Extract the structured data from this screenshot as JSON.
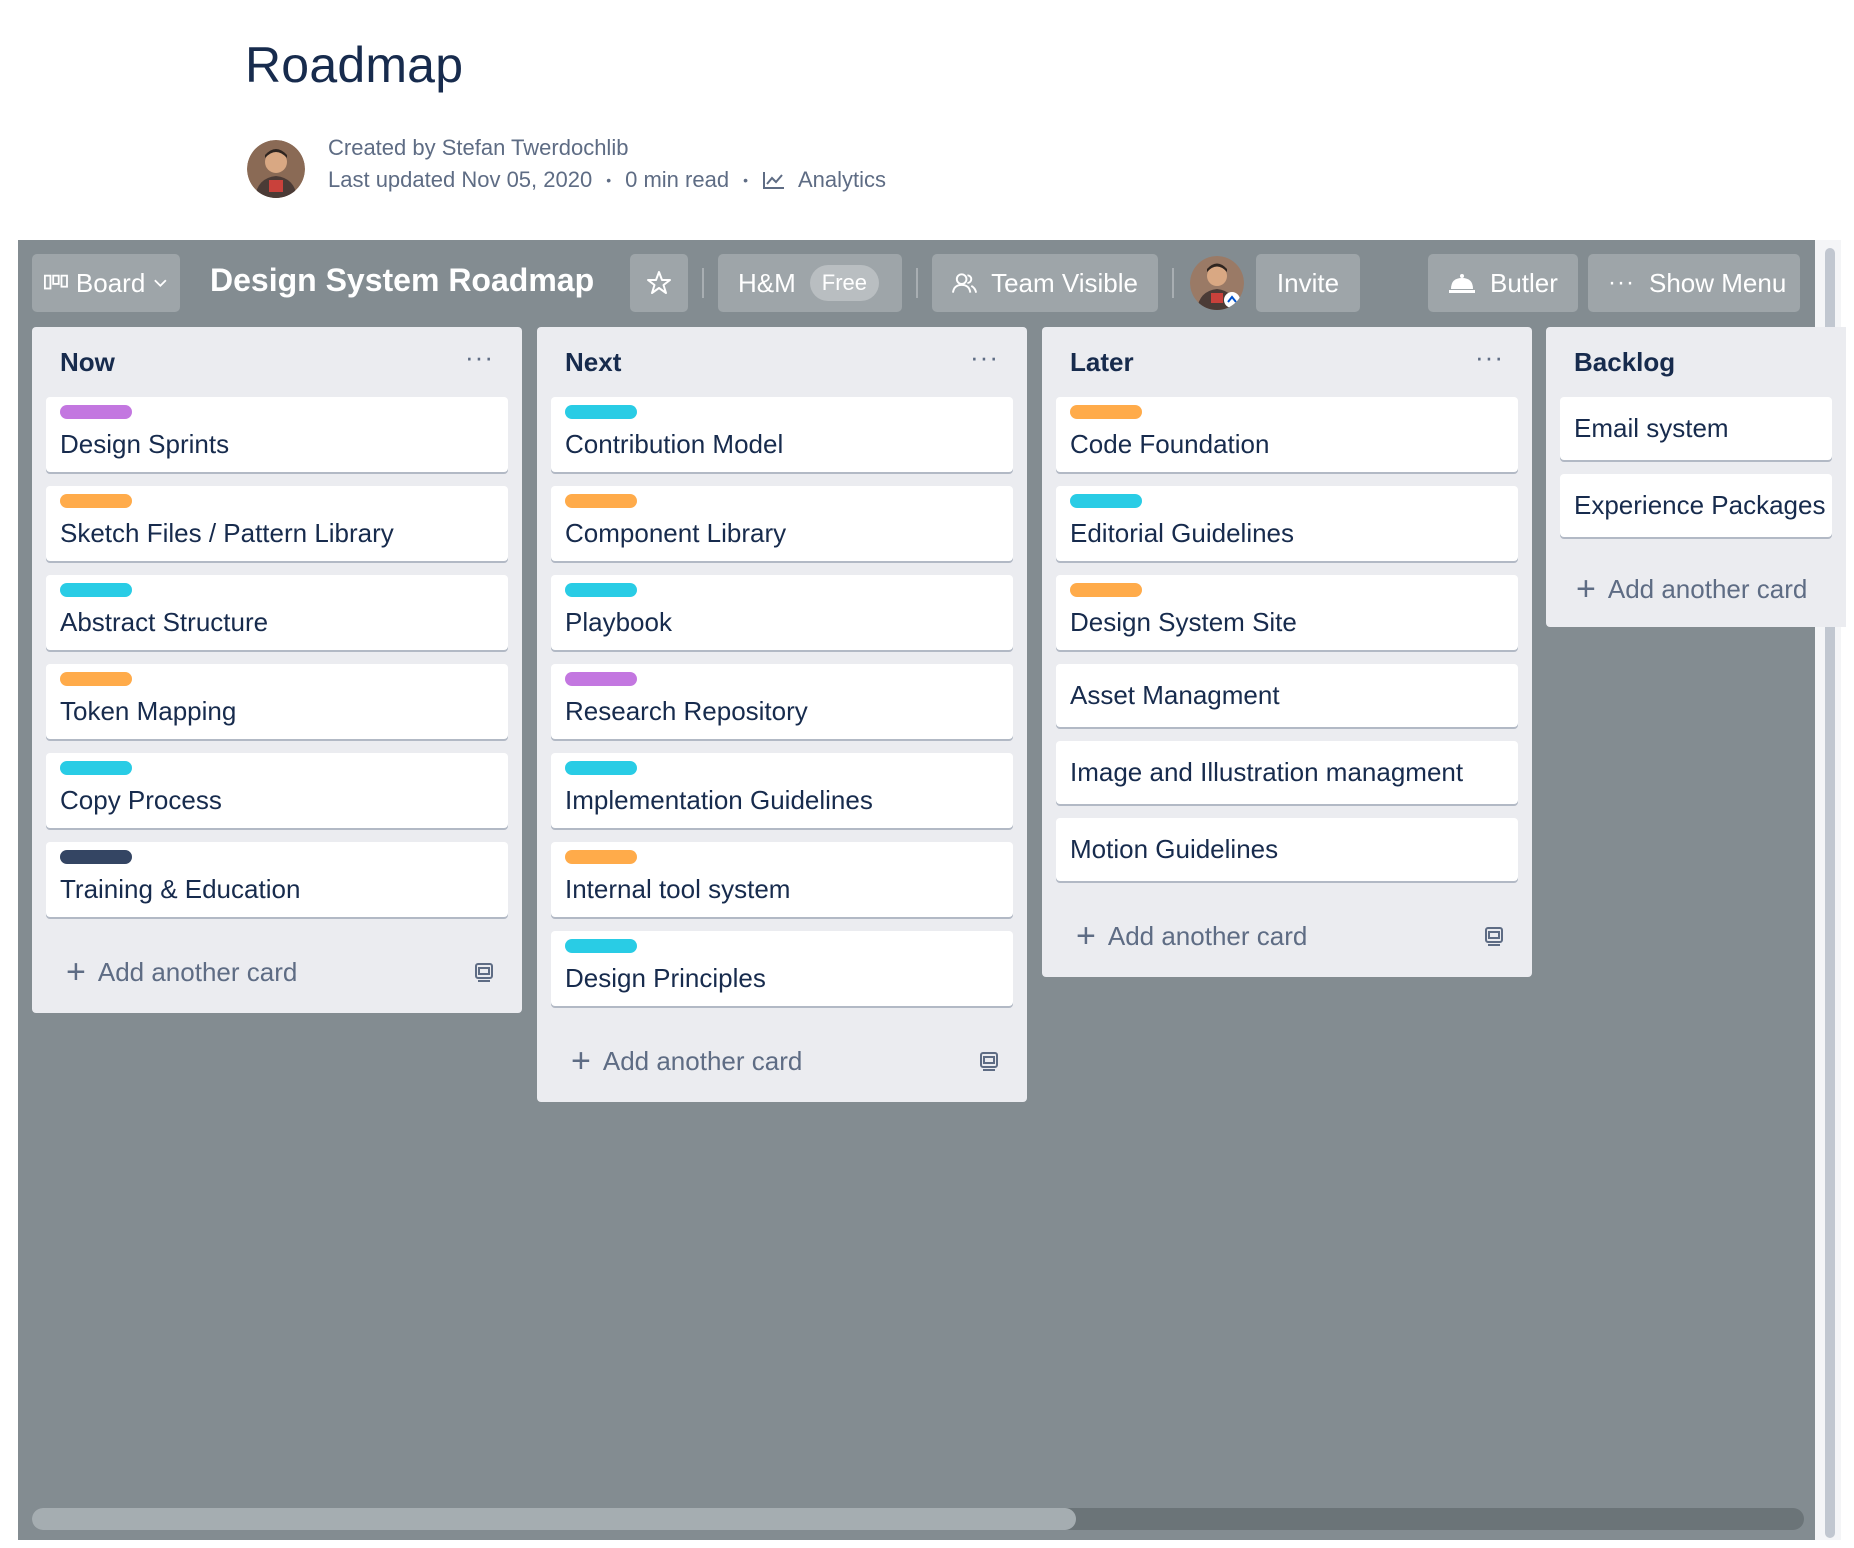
{
  "page": {
    "title": "Roadmap",
    "created_by": "Created by Stefan Twerdochlib",
    "last_updated": "Last updated Nov 05, 2020",
    "read_time": "0 min read",
    "analytics": "Analytics",
    "separator": "•"
  },
  "toolbar": {
    "board_switch": "Board",
    "board_title": "Design System Roadmap",
    "workspace": "H&M",
    "workspace_badge": "Free",
    "visibility": "Team Visible",
    "invite": "Invite",
    "butler": "Butler",
    "show_menu": "Show Menu"
  },
  "label_colors": {
    "purple": "#c377e0",
    "orange": "#ffab4a",
    "sky": "#29cce5",
    "navy": "#344563"
  },
  "board_background": "#838c91",
  "lists": [
    {
      "title": "Now",
      "menu": "···",
      "add": "Add another card",
      "cards": [
        {
          "text": "Design Sprints",
          "label": "purple"
        },
        {
          "text": "Sketch Files / Pattern Library",
          "label": "orange"
        },
        {
          "text": "Abstract Structure",
          "label": "sky"
        },
        {
          "text": "Token Mapping",
          "label": "orange"
        },
        {
          "text": "Copy Process",
          "label": "sky"
        },
        {
          "text": "Training & Education",
          "label": "navy"
        }
      ]
    },
    {
      "title": "Next",
      "menu": "···",
      "add": "Add another card",
      "cards": [
        {
          "text": "Contribution Model",
          "label": "sky"
        },
        {
          "text": "Component Library",
          "label": "orange"
        },
        {
          "text": "Playbook",
          "label": "sky"
        },
        {
          "text": "Research Repository",
          "label": "purple"
        },
        {
          "text": "Implementation Guidelines",
          "label": "sky"
        },
        {
          "text": "Internal tool system",
          "label": "orange"
        },
        {
          "text": "Design Principles",
          "label": "sky"
        }
      ]
    },
    {
      "title": "Later",
      "menu": "···",
      "add": "Add another card",
      "cards": [
        {
          "text": "Code Foundation",
          "label": "orange"
        },
        {
          "text": "Editorial Guidelines",
          "label": "sky"
        },
        {
          "text": "Design System Site",
          "label": "orange"
        },
        {
          "text": "Asset Managment",
          "label": null
        },
        {
          "text": "Image and Illustration managment",
          "label": null
        },
        {
          "text": "Motion Guidelines",
          "label": null
        }
      ]
    },
    {
      "title": "Backlog",
      "menu": "",
      "add": "Add another card",
      "cards": [
        {
          "text": "Email system",
          "label": null
        },
        {
          "text": "Experience Packages",
          "label": null
        }
      ]
    }
  ]
}
